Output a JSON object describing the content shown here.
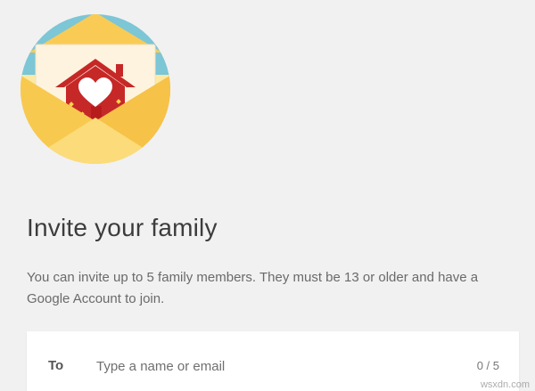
{
  "header": {
    "illustration_icon": "family-invite-envelope-icon"
  },
  "invite": {
    "title": "Invite your family",
    "description": "You can invite up to 5 family members. They must be 13 or older and have a Google Account to join."
  },
  "recipients": {
    "to_label": "To",
    "placeholder": "Type a name or email",
    "value": "",
    "count": "0 / 5"
  },
  "watermark": {
    "text": "wsxdn.com"
  },
  "colors": {
    "background": "#f1f1f1",
    "circle_sky": "#7cc6d6",
    "circle_sun": "#fde8a4",
    "envelope": "#fbd56a",
    "house": "#c62828",
    "heart": "#ffffff",
    "sparkle": "#ffd54f"
  }
}
